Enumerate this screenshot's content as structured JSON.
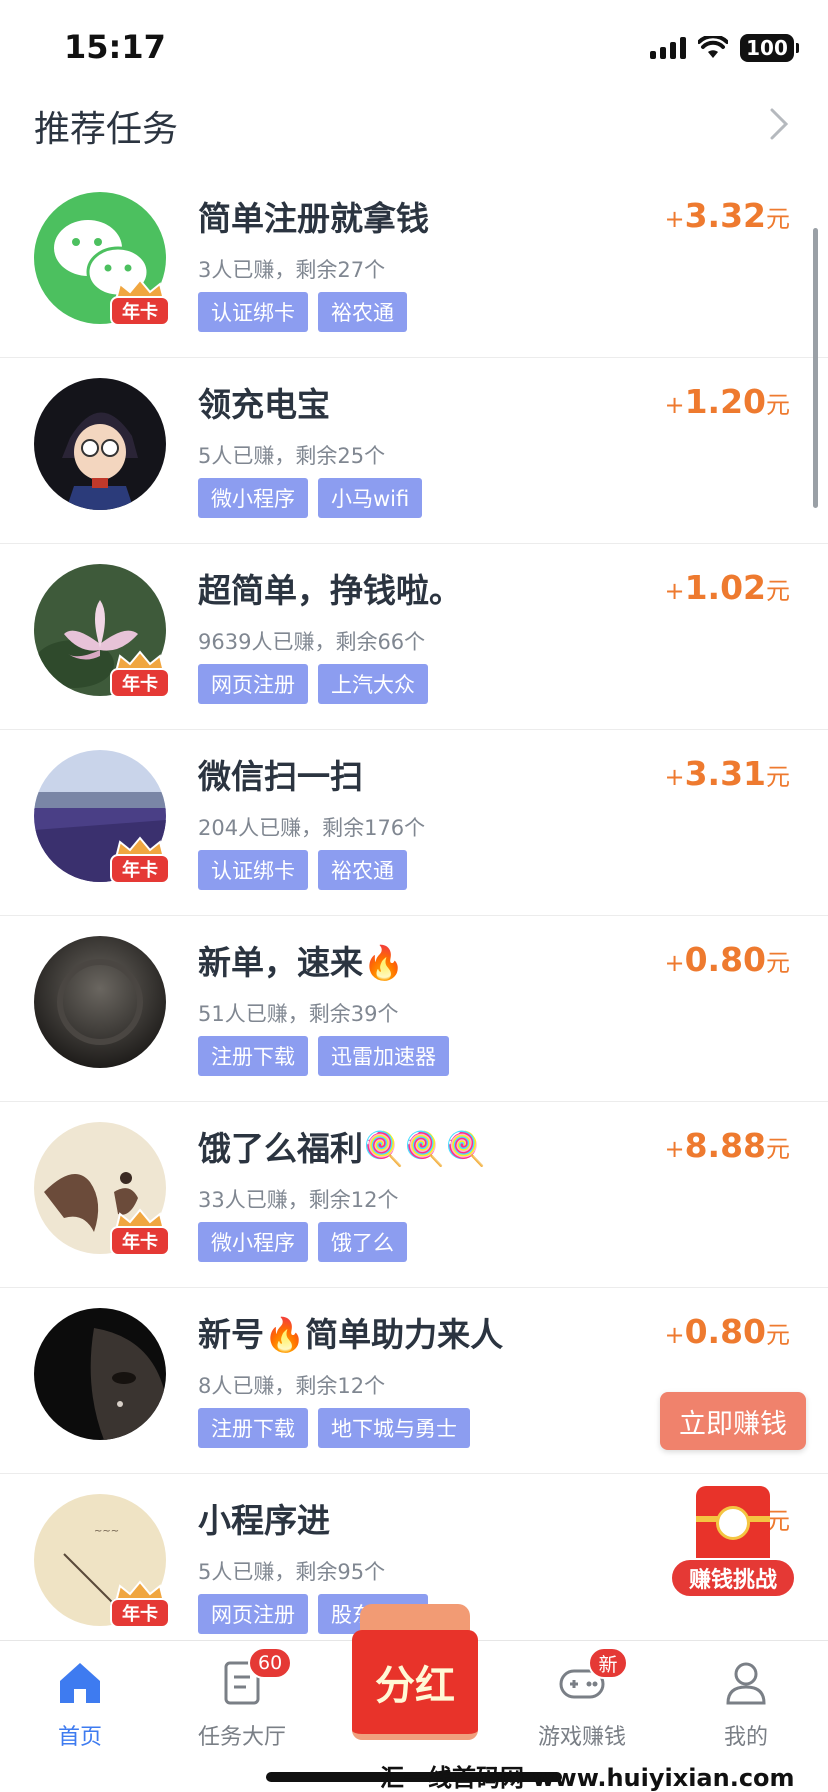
{
  "status_bar": {
    "time": "15:17",
    "battery": "100"
  },
  "header": {
    "title": "推荐任务"
  },
  "tasks": [
    {
      "title": "简单注册就拿钱",
      "progress": "3人已赚，剩余27个",
      "tags": [
        "认证绑卡",
        "裕农通"
      ],
      "plus": "+",
      "amount": "3.32",
      "unit": "元",
      "badge": "年卡",
      "avatar_icon": "wechat-logo"
    },
    {
      "title": "领充电宝",
      "progress": "5人已赚，剩余25个",
      "tags": [
        "微小程序",
        "小马wifi"
      ],
      "plus": "+",
      "amount": "1.20",
      "unit": "元",
      "badge": "",
      "avatar_icon": "cartoon-avatar"
    },
    {
      "title": "超简单，挣钱啦。",
      "progress": "9639人已赚，剩余66个",
      "tags": [
        "网页注册",
        "上汽大众"
      ],
      "plus": "+",
      "amount": "1.02",
      "unit": "元",
      "badge": "年卡",
      "avatar_icon": "lotus-photo"
    },
    {
      "title": "微信扫一扫",
      "progress": "204人已赚，剩余176个",
      "tags": [
        "认证绑卡",
        "裕农通"
      ],
      "plus": "+",
      "amount": "3.31",
      "unit": "元",
      "badge": "年卡",
      "avatar_icon": "lavender-field-photo"
    },
    {
      "title": "新单，速来🔥",
      "progress": "51人已赚，剩余39个",
      "tags": [
        "注册下载",
        "迅雷加速器"
      ],
      "plus": "+",
      "amount": "0.80",
      "unit": "元",
      "badge": "",
      "avatar_icon": "dark-sphere"
    },
    {
      "title": "饿了么福利🍭🍭🍭",
      "progress": "33人已赚，剩余12个",
      "tags": [
        "微小程序",
        "饿了么"
      ],
      "plus": "+",
      "amount": "8.88",
      "unit": "元",
      "badge": "年卡",
      "avatar_icon": "illustration"
    },
    {
      "title": "新号🔥简单助力来人",
      "progress": "8人已赚，剩余12个",
      "tags": [
        "注册下载",
        "地下城与勇士"
      ],
      "plus": "+",
      "amount": "0.80",
      "unit": "元",
      "badge": "",
      "avatar_icon": "portrait-photo"
    },
    {
      "title": "小程序进",
      "progress": "5人已赚，剩余95个",
      "tags": [
        "网页注册",
        "股东身云"
      ],
      "plus": "+",
      "amount": "",
      "unit": "元",
      "badge": "年卡",
      "avatar_icon": "painting"
    }
  ],
  "floating": {
    "earn_now": "立即赚钱",
    "challenge": "赚钱挑战"
  },
  "tab_bar": {
    "home": "首页",
    "tasks": "任务大厅",
    "tasks_badge": "60",
    "dividend": "分红",
    "games": "游戏赚钱",
    "games_badge": "新",
    "mine": "我的"
  },
  "watermark": "汇一线首码网 www.huiyixian.com",
  "colors": {
    "accent": "#3e7bf0",
    "reward": "#ee7a2f",
    "tag": "#8c9df0",
    "badge_red": "#e53935"
  }
}
